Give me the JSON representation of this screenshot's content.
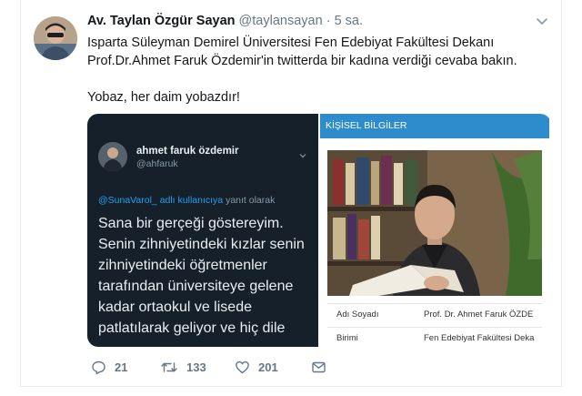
{
  "tweet": {
    "author_name": "Av. Taylan Özgür Sayan",
    "author_handle": "@taylansayan",
    "separator": "·",
    "time": "5 sa.",
    "text_lines": [
      "Isparta Süleyman Demirel Üniversitesi Fen Edebiyat Fakültesi Dekanı",
      "Prof.Dr.Ahmet Faruk Özdemir'in twitterda bir kadına verdiği cevaba bakın.",
      "Yobaz, her daim yobazdır!"
    ],
    "embedded": {
      "name": "ahmet faruk özdemir",
      "handle": "@ahfaruk",
      "reply_mention": "@SunaVarol_ adlı kullanıcıya",
      "reply_suffix": "yanıt olarak",
      "text_lines": [
        "Sana bir gerçeği göstereyim.",
        "Senin zihniyetindeki kızlar senin",
        "zihniyetindeki öğretmenler",
        "tarafından üniversiteye gelene",
        "kadar ortaokul ve lisede",
        "patlatılarak geliyor ve hiç dile"
      ]
    },
    "profile_panel": {
      "header": "KİŞİSEL BİLGİLER",
      "rows": [
        {
          "label": "Adı Soyadı",
          "value": "Prof. Dr. Ahmet Faruk ÖZDE"
        },
        {
          "label": "Birimi",
          "value": "Fen Edebiyat Fakültesi Deka"
        }
      ]
    },
    "actions": {
      "reply_count": "21",
      "retweet_count": "133",
      "like_count": "201"
    },
    "icons": {
      "reply": "reply-icon",
      "retweet": "retweet-icon",
      "like": "heart-icon",
      "dm": "envelope-icon",
      "menu": "chevron-down-icon"
    },
    "colors": {
      "link": "#1da1f2",
      "muted": "#657786",
      "embedded_bg": "#15202b",
      "panel_header": "#2f8ccc"
    }
  }
}
